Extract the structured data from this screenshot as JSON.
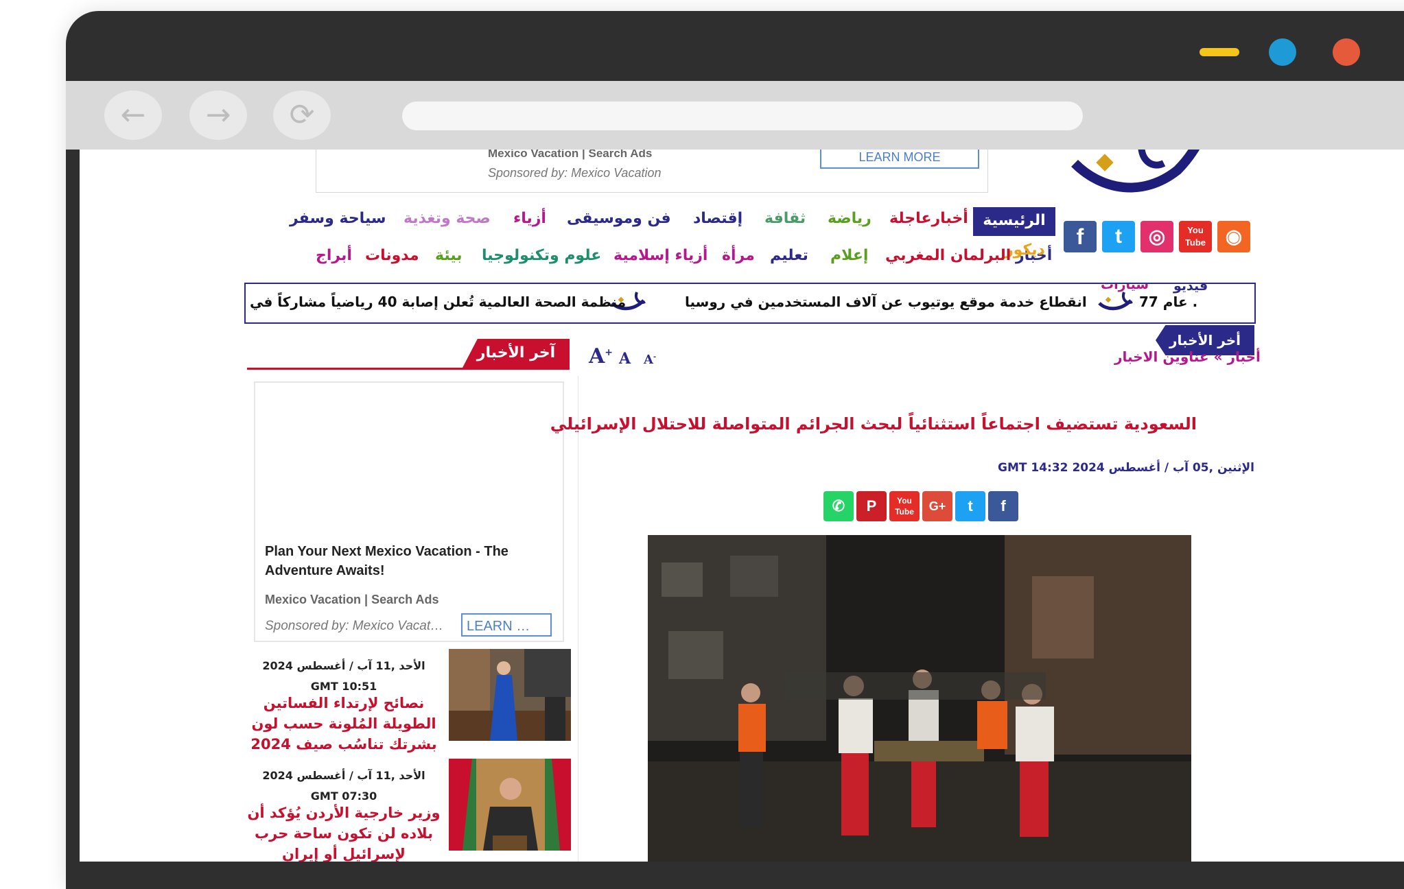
{
  "browser": {
    "back_icon": "arrow-left-icon",
    "forward_icon": "arrow-right-icon",
    "reload_icon": "reload-icon",
    "url": ""
  },
  "ad_top": {
    "line1": "Mexico Vacation | Search Ads",
    "line2": "Sponsored by: Mexico Vacation",
    "button": "LEARN MORE"
  },
  "social_icons": [
    "facebook-icon",
    "twitter-icon",
    "instagram-icon",
    "youtube-icon",
    "rss-icon"
  ],
  "nav": {
    "row1": {
      "home": "الرئيسية",
      "breaking": "أخبارعاجلة",
      "sports": "رياضة",
      "culture": "ثقافة",
      "economy": "إقتصاد",
      "art_music": "فن وموسيقى",
      "fashion": "أزياء",
      "health": "صحة وتغذية",
      "travel": "سياحة وسفر"
    },
    "row2": {
      "news": "أخبار",
      "decor": "ديكور",
      "parliament": "البرلمان المغربي",
      "media": "إعلام",
      "education": "تعليم",
      "woman": "مرأة",
      "islamic_fashion": "أزياء إسلامية",
      "science_tech": "علوم وتكنولوجيا",
      "environment": "بيئة",
      "blogs": "مدونات",
      "horoscope": "أبراج"
    },
    "row3": {
      "video": "فيديو",
      "cars": "سيارات"
    }
  },
  "ticker": {
    "items": [
      "77 عام .",
      "انقطاع خدمة موقع يوتيوب عن آلاف المستخدمين في روسيا",
      "منظمة الصحة العالمية تُعلن إصابة 40 رياضياً مشاركاً في"
    ]
  },
  "latest_tab": "أخر الأخبار",
  "breadcrumb": {
    "root": "أخبار",
    "sep": "»",
    "current": "عناوين الاخبار"
  },
  "font_size": {
    "increase": "A+",
    "normal": "A",
    "decrease": "A-"
  },
  "sidebar": {
    "heading": "آخر الأخبار",
    "ad": {
      "title": "Plan Your Next Mexico Vacation - The Adventure Awaits!",
      "source": "Mexico Vacation | Search Ads",
      "sponsor": "Sponsored by: Mexico Vacat…",
      "button": "LEARN …"
    },
    "items": [
      {
        "date": "الأحد ,11 آب / أغسطس 2024 GMT 10:51",
        "title": "نصائح لإرتداء الفساتين الطويلة المُلونة حسب لون بشرتك تناسُب صيف 2024"
      },
      {
        "date": "الأحد ,11 آب / أغسطس 2024 GMT 07:30",
        "title": "وزير خارجية الأردن يُؤكد أن بلاده لن تكون ساحة حرب لإسرائيل أو إيران"
      }
    ]
  },
  "article": {
    "headline": "السعودية تستضيف اجتماعاً استثنائياً لبحث الجرائم المتواصلة للاحتلال الإسرائيلي",
    "date": "الإثنين ,05 آب / أغسطس 2024 GMT 14:32",
    "share_icons": [
      "facebook-icon",
      "twitter-icon",
      "google-plus-icon",
      "youtube-icon",
      "pinterest-icon",
      "whatsapp-icon"
    ],
    "social_labels": {
      "facebook": "f",
      "twitter": "t",
      "googleplus": "G+",
      "youtube": "You Tube",
      "pinterest": "P",
      "whatsapp": "✆",
      "instagram": "◎",
      "rss": "◉"
    }
  },
  "colors": {
    "brand_navy": "#2b2a88",
    "accent_red": "#c8102e",
    "purple": "#b5188c"
  }
}
